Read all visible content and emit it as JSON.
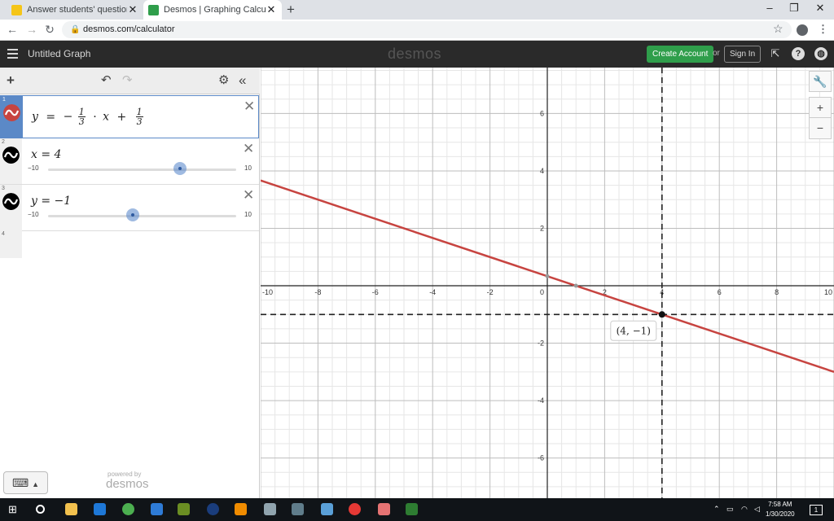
{
  "browser": {
    "tabs": [
      {
        "title": "Answer students' questions and e",
        "active": false
      },
      {
        "title": "Desmos | Graphing Calculator",
        "active": true
      }
    ],
    "url": "desmos.com/calculator",
    "window_controls": {
      "minimize": "–",
      "restore": "❐",
      "close": "✕"
    }
  },
  "header": {
    "title": "Untitled Graph",
    "logo": "desmos",
    "create_account": "Create Account",
    "or": "or",
    "sign_in": "Sign In"
  },
  "expressions": [
    {
      "index": "1",
      "kind": "line",
      "color": "#c74440",
      "parts": {
        "lhs": "y",
        "eq": "=",
        "minus": "−",
        "num1": "1",
        "den1": "3",
        "dot": "·",
        "var": "x",
        "plus": "+",
        "num2": "1",
        "den2": "3"
      }
    },
    {
      "index": "2",
      "kind": "slider",
      "text": "x = 4",
      "min": "−10",
      "max": "10",
      "value": 4,
      "color": "#000000"
    },
    {
      "index": "3",
      "kind": "slider",
      "text": "y = −1",
      "min": "−10",
      "max": "10",
      "value": -1,
      "color": "#000000"
    },
    {
      "index": "4",
      "kind": "empty"
    }
  ],
  "branding": {
    "powered_by": "powered by",
    "logo": "desmos"
  },
  "graph": {
    "x_range": [
      -10,
      10
    ],
    "y_range": [
      -7.4,
      7.6
    ],
    "x_ticks": [
      "-10",
      "-8",
      "-6",
      "-4",
      "-2",
      "0",
      "2",
      "4",
      "6",
      "8",
      "10"
    ],
    "y_ticks": [
      "6",
      "4",
      "2",
      "-2",
      "-4",
      "-6"
    ],
    "line": {
      "slope": -0.3333,
      "intercept": 0.3333,
      "color": "#c74440"
    },
    "vertical_dashed": 4,
    "horizontal_dashed": -1,
    "point": {
      "x": 4,
      "y": -1,
      "label": "(4, −1)"
    }
  },
  "taskbar": {
    "time": "7:58 AM",
    "date": "1/30/2020",
    "notifications": "1"
  }
}
